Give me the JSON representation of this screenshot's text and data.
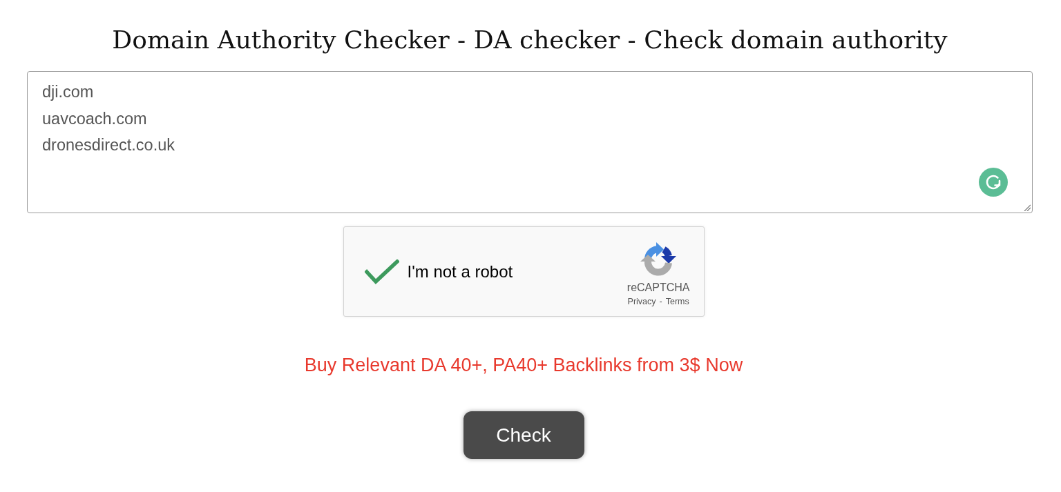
{
  "title": "Domain Authority Checker - DA checker - Check domain authority",
  "domains_input": {
    "value": "dji.com\nuavcoach.com\ndronesdirect.co.uk"
  },
  "captcha": {
    "label": "I'm not a robot",
    "checked": true,
    "brand": "reCAPTCHA",
    "links": [
      "Privacy",
      "Terms"
    ],
    "separator": "-"
  },
  "promo_link": "Buy Relevant DA 40+, PA40+ Backlinks from 3$ Now",
  "check_button": {
    "label": "Check"
  }
}
